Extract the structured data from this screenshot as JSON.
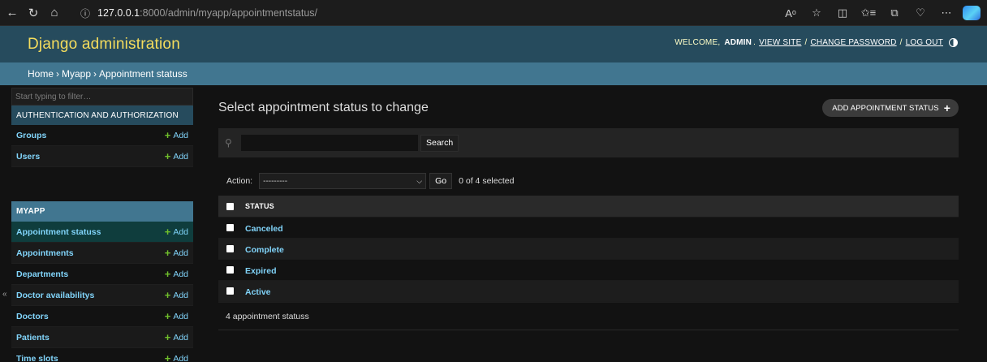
{
  "browser": {
    "url_host": "127.0.0.1",
    "url_path": ":8000/admin/myapp/appointmentstatus/"
  },
  "header": {
    "branding": "Django administration",
    "welcome": "Welcome,",
    "user": "admin",
    "view_site": "View site",
    "change_password": "Change password",
    "log_out": "Log out"
  },
  "breadcrumbs": {
    "home": "Home",
    "app": "Myapp",
    "current": "Appointment statuss"
  },
  "sidebar": {
    "filter_placeholder": "Start typing to filter…",
    "auth_module": {
      "caption": "Authentication and Authorization",
      "items": [
        {
          "name": "Groups",
          "add": "Add"
        },
        {
          "name": "Users",
          "add": "Add"
        }
      ]
    },
    "app_module": {
      "caption": "Myapp",
      "items": [
        {
          "name": "Appointment statuss",
          "add": "Add"
        },
        {
          "name": "Appointments",
          "add": "Add"
        },
        {
          "name": "Departments",
          "add": "Add"
        },
        {
          "name": "Doctor availabilitys",
          "add": "Add"
        },
        {
          "name": "Doctors",
          "add": "Add"
        },
        {
          "name": "Patients",
          "add": "Add"
        },
        {
          "name": "Time slots",
          "add": "Add"
        }
      ]
    },
    "collapse_glyph": "«"
  },
  "content": {
    "title": "Select appointment status to change",
    "add_button": "Add appointment status",
    "search_button": "Search",
    "search_value": "",
    "action_label": "Action:",
    "action_selected": "---------",
    "go_button": "Go",
    "selected_count": "0 of 4 selected",
    "column_header": "Status",
    "rows": [
      "Canceled",
      "Complete",
      "Expired",
      "Active"
    ],
    "paginator": "4 appointment statuss"
  },
  "colors": {
    "header_bg": "#264b5d",
    "breadcrumb_bg": "#417690",
    "branding": "#f5dd5d",
    "link": "#81d4fa",
    "add_plus": "#70bf2b"
  }
}
